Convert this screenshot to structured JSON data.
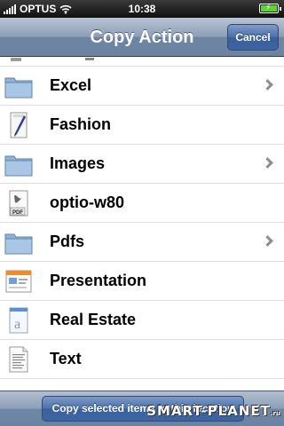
{
  "status_bar": {
    "carrier": "OPTUS",
    "time": "10:38",
    "battery_level": 1.0,
    "battery_color": "#5cd62e"
  },
  "nav": {
    "title": "Copy Action",
    "cancel_label": "Cancel"
  },
  "list": {
    "items": [
      {
        "label": "Excel",
        "icon": "folder-icon",
        "has_chevron": true
      },
      {
        "label": "Fashion",
        "icon": "document-quill-icon",
        "has_chevron": false
      },
      {
        "label": "Images",
        "icon": "folder-icon",
        "has_chevron": true
      },
      {
        "label": "optio-w80",
        "icon": "pdf-file-icon",
        "has_chevron": false
      },
      {
        "label": "Pdfs",
        "icon": "folder-icon",
        "has_chevron": true
      },
      {
        "label": "Presentation",
        "icon": "presentation-file-icon",
        "has_chevron": false
      },
      {
        "label": "Real Estate",
        "icon": "text-document-icon",
        "has_chevron": false
      },
      {
        "label": "Text",
        "icon": "plain-text-file-icon",
        "has_chevron": false
      }
    ]
  },
  "toolbar": {
    "copy_label": "Copy selected items to this location"
  },
  "watermark": {
    "text": "SMART-PLANET",
    "suffix": ".ru"
  },
  "colors": {
    "nav_bar": "#6d84a2",
    "button_blue": "#3d64a2",
    "folder_blue": "#7fa7cf"
  }
}
